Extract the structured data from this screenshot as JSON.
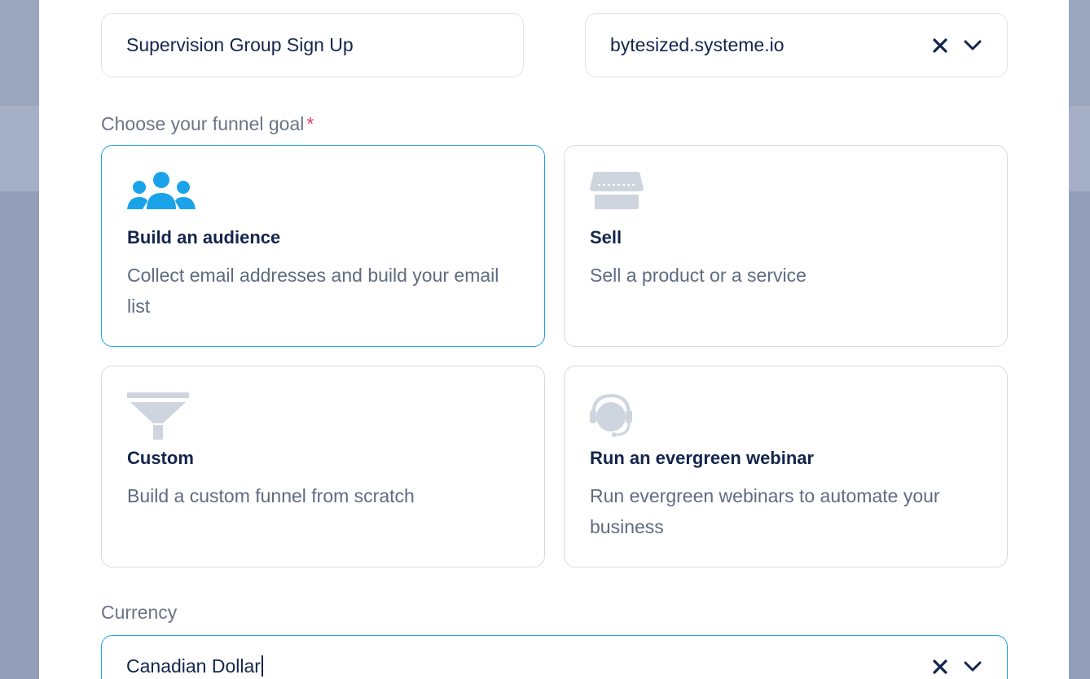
{
  "funnel_name": {
    "value": "Supervision Group Sign Up"
  },
  "domain_select": {
    "value": "bytesized.systeme.io",
    "clear_icon": "close-icon",
    "toggle_icon": "chevron-down-icon"
  },
  "goal_section": {
    "label": "Choose your funnel goal",
    "required_marker": "*"
  },
  "goals": [
    {
      "id": "audience",
      "title": "Build an audience",
      "description": "Collect email addresses and build your email list",
      "icon": "people-icon",
      "selected": true,
      "icon_color": "#1aa3e8"
    },
    {
      "id": "sell",
      "title": "Sell",
      "description": "Sell a product or a service",
      "icon": "storefront-icon",
      "selected": false,
      "icon_color": "#cfd5df"
    },
    {
      "id": "custom",
      "title": "Custom",
      "description": "Build a custom funnel from scratch",
      "icon": "funnel-icon",
      "selected": false,
      "icon_color": "#cfd5df"
    },
    {
      "id": "webinar",
      "title": "Run an evergreen webinar",
      "description": "Run evergreen webinars to automate your business",
      "icon": "headset-icon",
      "selected": false,
      "icon_color": "#cfd5df"
    }
  ],
  "currency_section": {
    "label": "Currency"
  },
  "currency_select": {
    "value": "Canadian Dollar",
    "clear_icon": "close-icon",
    "toggle_icon": "chevron-down-icon"
  },
  "colors": {
    "accent": "#1aa3e8",
    "text_dark": "#14254d",
    "text_muted": "#5f6b80",
    "required": "#e8385c"
  }
}
